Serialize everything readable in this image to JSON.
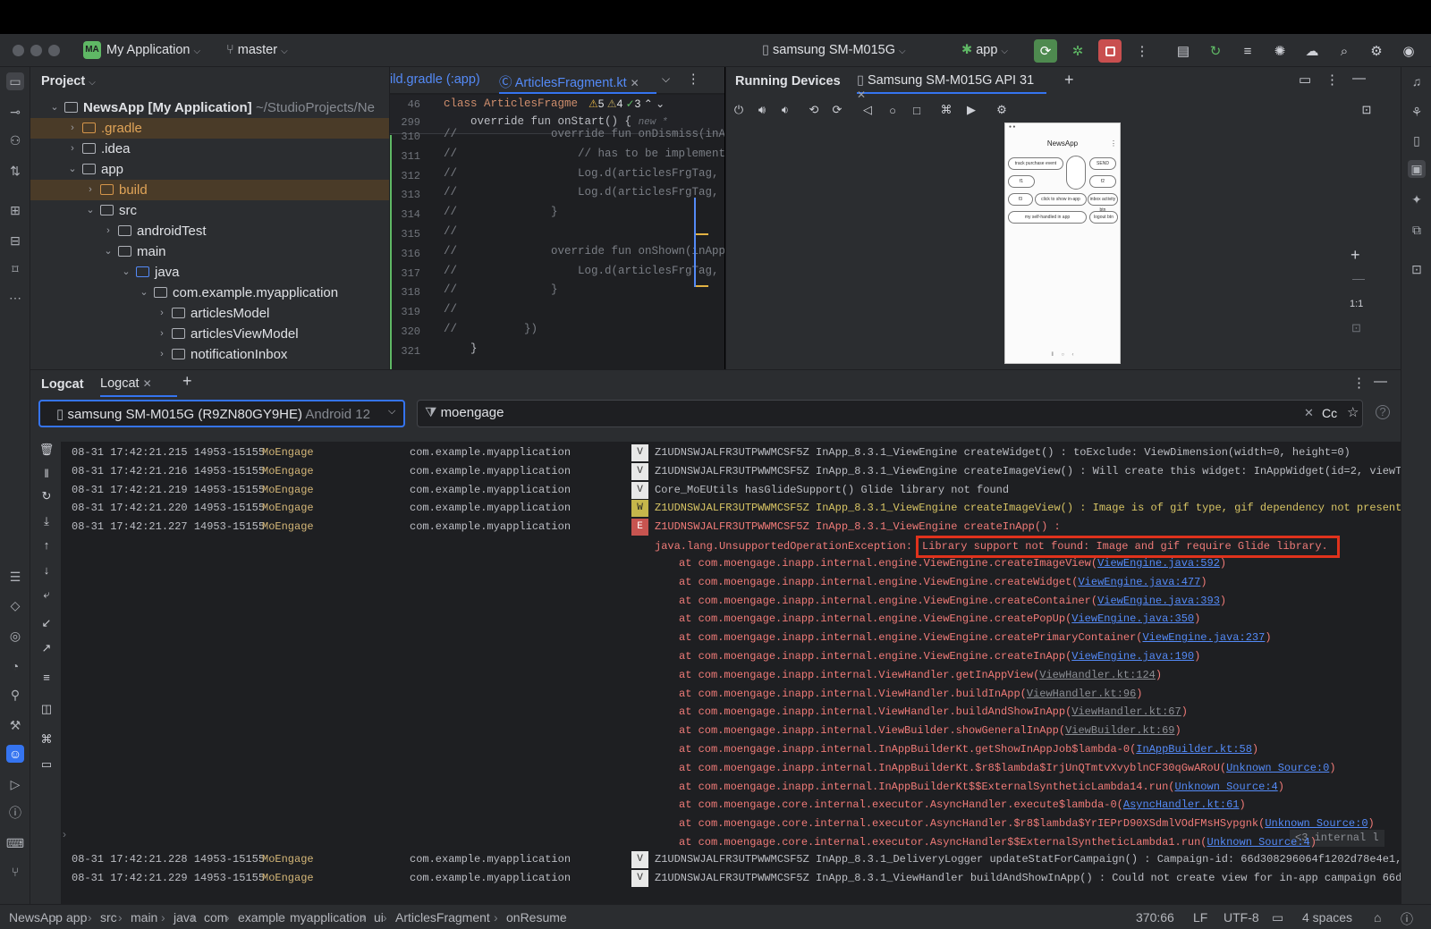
{
  "titlebar": {
    "project_badge": "MA",
    "project_name": "My Application",
    "branch": "master",
    "device": "samsung SM-M015G",
    "run_config": "app"
  },
  "project_panel": {
    "title": "Project",
    "tree": [
      {
        "label": "NewsApp [My Application]",
        "suffix": "~/StudioProjects/Ne",
        "depth": 0,
        "open": true,
        "bold": true
      },
      {
        "label": ".gradle",
        "depth": 1,
        "open": false,
        "highlight": "orange"
      },
      {
        "label": ".idea",
        "depth": 1,
        "open": false
      },
      {
        "label": "app",
        "depth": 1,
        "open": true
      },
      {
        "label": "build",
        "depth": 2,
        "open": false,
        "highlight": "orange"
      },
      {
        "label": "src",
        "depth": 2,
        "open": true
      },
      {
        "label": "androidTest",
        "depth": 3,
        "open": false
      },
      {
        "label": "main",
        "depth": 3,
        "open": true
      },
      {
        "label": "java",
        "depth": 4,
        "open": true
      },
      {
        "label": "com.example.myapplication",
        "depth": 5,
        "open": true
      },
      {
        "label": "articlesModel",
        "depth": 6,
        "open": false
      },
      {
        "label": "articlesViewModel",
        "depth": 6,
        "open": false
      },
      {
        "label": "notificationInbox",
        "depth": 6,
        "open": false
      }
    ]
  },
  "editor": {
    "tabs": [
      {
        "label": "ild.gradle (:app)"
      },
      {
        "label": "ArticlesFragment.kt",
        "active": true
      }
    ],
    "inspection": {
      "warnings": "5",
      "weak_warnings": "4",
      "ok": "3"
    },
    "sticky": [
      {
        "num": "46",
        "text": "class ArticlesFragme"
      },
      {
        "num": "299",
        "text": "    override fun onStart() {",
        "hint": "new *"
      }
    ],
    "lines": [
      {
        "num": "310",
        "text": "//              override fun onDismiss(inA"
      },
      {
        "num": "311",
        "text": "//                  // has to be implement"
      },
      {
        "num": "312",
        "text": "//                  Log.d(articlesFrgTag,"
      },
      {
        "num": "313",
        "text": "//                  Log.d(articlesFrgTag,"
      },
      {
        "num": "314",
        "text": "//              }"
      },
      {
        "num": "315",
        "text": "//"
      },
      {
        "num": "316",
        "text": "//              override fun onShown(inApp"
      },
      {
        "num": "317",
        "text": "//                  Log.d(articlesFrgTag,"
      },
      {
        "num": "318",
        "text": "//              }"
      },
      {
        "num": "319",
        "text": "//"
      },
      {
        "num": "320",
        "text": "//          })"
      },
      {
        "num": "321",
        "text": "    }"
      }
    ]
  },
  "devices": {
    "title": "Running Devices",
    "tab": "Samsung SM-M015G API 31",
    "zoom_label": "1:1",
    "phone": {
      "app_title": "NewsApp",
      "buttons": [
        "track purchase event",
        "SEND",
        "f1",
        "f2",
        "f3",
        "click to show in-app",
        "inbox activity btn",
        "my self-handled in app",
        "logout btn"
      ]
    }
  },
  "logcat": {
    "title": "Logcat",
    "tab": "Logcat",
    "device_select": "samsung SM-M015G (R9ZN80GY9HE)",
    "device_os": "Android 12",
    "filter": "moengage",
    "filter_case": "Cc",
    "entries_top": [
      {
        "date": "08-31 17:42:21.215 14953-15155",
        "tag": "MoEngage",
        "pkg": "com.example.myapplication",
        "level": "V",
        "msg": "Z1UDNSWJALFR3UTPWWMCSF5Z InApp_8.3.1_ViewEngine createWidget() : toExclude: ViewDimension(width=0, height=0)"
      },
      {
        "date": "08-31 17:42:21.216 14953-15155",
        "tag": "MoEngage",
        "pkg": "com.example.myapplication",
        "level": "V",
        "msg": "Z1UDNSWJALFR3UTPWWMCSF5Z InApp_8.3.1_ViewEngine createImageView() : Will create this widget: InAppWidget(id=2, viewTy"
      },
      {
        "date": "08-31 17:42:21.219 14953-15155",
        "tag": "MoEngage",
        "pkg": "com.example.myapplication",
        "level": "V",
        "msg": "Core_MoEUtils hasGlideSupport() Glide library not found"
      },
      {
        "date": "08-31 17:42:21.220 14953-15155",
        "tag": "MoEngage",
        "pkg": "com.example.myapplication",
        "level": "W",
        "msg": "Z1UDNSWJALFR3UTPWWMCSF5Z InApp_8.3.1_ViewEngine createImageView() : Image is of gif type, gif dependency not present"
      },
      {
        "date": "08-31 17:42:21.227 14953-15155",
        "tag": "MoEngage",
        "pkg": "com.example.myapplication",
        "level": "E",
        "msg": "Z1UDNSWJALFR3UTPWWMCSF5Z InApp_8.3.1_ViewEngine createInApp() :"
      }
    ],
    "exception_prefix": "java.lang.UnsupportedOperationException:",
    "exception_msg": "Library support not found: Image and gif require Glide library.",
    "stack": [
      {
        "text": "at com.moengage.inapp.internal.engine.ViewEngine.createImageView(",
        "link": "ViewEngine.java:592",
        "grey": false
      },
      {
        "text": "at com.moengage.inapp.internal.engine.ViewEngine.createWidget(",
        "link": "ViewEngine.java:477",
        "grey": false
      },
      {
        "text": "at com.moengage.inapp.internal.engine.ViewEngine.createContainer(",
        "link": "ViewEngine.java:393",
        "grey": false
      },
      {
        "text": "at com.moengage.inapp.internal.engine.ViewEngine.createPopUp(",
        "link": "ViewEngine.java:350",
        "grey": false
      },
      {
        "text": "at com.moengage.inapp.internal.engine.ViewEngine.createPrimaryContainer(",
        "link": "ViewEngine.java:237",
        "grey": false
      },
      {
        "text": "at com.moengage.inapp.internal.engine.ViewEngine.createInApp(",
        "link": "ViewEngine.java:190",
        "grey": false
      },
      {
        "text": "at com.moengage.inapp.internal.ViewHandler.getInAppView(",
        "link": "ViewHandler.kt:124",
        "grey": true
      },
      {
        "text": "at com.moengage.inapp.internal.ViewHandler.buildInApp(",
        "link": "ViewHandler.kt:96",
        "grey": true
      },
      {
        "text": "at com.moengage.inapp.internal.ViewHandler.buildAndShowInApp(",
        "link": "ViewHandler.kt:67",
        "grey": true
      },
      {
        "text": "at com.moengage.inapp.internal.ViewBuilder.showGeneralInApp(",
        "link": "ViewBuilder.kt:69",
        "grey": true
      },
      {
        "text": "at com.moengage.inapp.internal.InAppBuilderKt.getShowInAppJob$lambda-0(",
        "link": "InAppBuilder.kt:58",
        "grey": false
      },
      {
        "text": "at com.moengage.inapp.internal.InAppBuilderKt.$r8$lambda$IrjUnQTmtvXvyblnCF30qGwARoU(",
        "link": "Unknown Source:0",
        "grey": false
      },
      {
        "text": "at com.moengage.inapp.internal.InAppBuilderKt$$ExternalSyntheticLambda14.run(",
        "link": "Unknown Source:4",
        "grey": false
      },
      {
        "text": "at com.moengage.core.internal.executor.AsyncHandler.execute$lambda-0(",
        "link": "AsyncHandler.kt:61",
        "grey": false
      },
      {
        "text": "at com.moengage.core.internal.executor.AsyncHandler.$r8$lambda$YrIEPrD90XSdmlVOdFMsHSypgnk(",
        "link": "Unknown Source:0",
        "grey": false
      },
      {
        "text": "at com.moengage.core.internal.executor.AsyncHandler$$ExternalSyntheticLambda1.run(",
        "link": "Unknown Source:4",
        "grey": false
      }
    ],
    "internal_badge": "<3 internal l",
    "entries_bottom": [
      {
        "date": "08-31 17:42:21.228 14953-15155",
        "tag": "MoEngage",
        "pkg": "com.example.myapplication",
        "level": "V",
        "msg": "Z1UDNSWJALFR3UTPWWMCSF5Z InApp_8.3.1_DeliveryLogger updateStatForCampaign() : Campaign-id: 66d308296064f1202d78e4e1,"
      },
      {
        "date": "08-31 17:42:21.229 14953-15155",
        "tag": "MoEngage",
        "pkg": "com.example.myapplication",
        "level": "V",
        "msg": "Z1UDNSWJALFR3UTPWWMCSF5Z InApp_8.3.1_ViewHandler buildAndShowInApp() : Could not create view for in-app campaign 66d3"
      }
    ]
  },
  "statusbar": {
    "breadcrumbs": [
      "NewsApp",
      "app",
      "src",
      "main",
      "java",
      "com",
      "example",
      "myapplication",
      "ui",
      "ArticlesFragment",
      "onResume"
    ],
    "position": "370:66",
    "line_sep": "LF",
    "encoding": "UTF-8",
    "indent": "4 spaces"
  },
  "colors": {
    "accent": "#548af7",
    "error": "#f07b78",
    "warning": "#d7c464",
    "highlight_box": "#e0321c"
  }
}
